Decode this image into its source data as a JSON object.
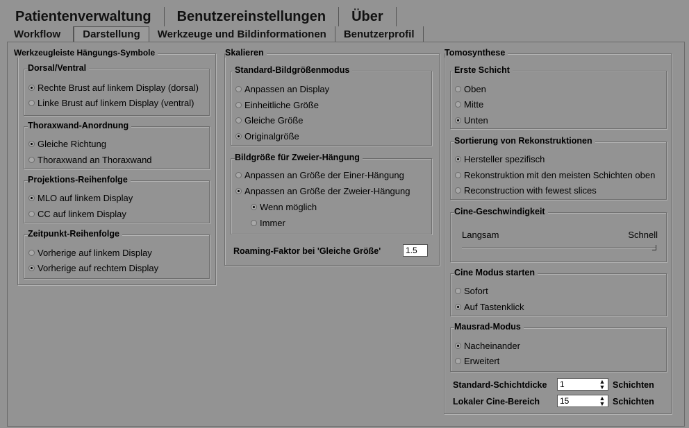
{
  "tabs_top": [
    "Patientenverwaltung",
    "Benutzereinstellungen",
    "Über"
  ],
  "tabs_sub": [
    "Workflow",
    "Darstellung",
    "Werkzeuge und Bildinformationen",
    "Benutzerprofil"
  ],
  "toolbar_group": {
    "title": "Werkzeugleiste Hängungs-Symbole",
    "dorsal": {
      "title": "Dorsal/Ventral",
      "options": [
        "Rechte Brust auf linkem Display (dorsal)",
        "Linke Brust auf linkem Display (ventral)"
      ],
      "selected": 0
    },
    "thorax": {
      "title": "Thoraxwand-Anordnung",
      "options": [
        "Gleiche Richtung",
        "Thoraxwand an Thoraxwand"
      ],
      "selected": 0
    },
    "projektion": {
      "title": "Projektions-Reihenfolge",
      "options": [
        "MLO auf linkem Display",
        "CC auf linkem Display"
      ],
      "selected": 0
    },
    "zeitpunkt": {
      "title": "Zeitpunkt-Reihenfolge",
      "options": [
        "Vorherige auf linkem Display",
        "Vorherige auf rechtem Display"
      ],
      "selected": 1
    }
  },
  "scale_group": {
    "title": "Skalieren",
    "standard": {
      "title": "Standard-Bildgrößenmodus",
      "options": [
        "Anpassen an Display",
        "Einheitliche Größe",
        "Gleiche Größe",
        "Originalgröße"
      ],
      "selected": 3
    },
    "zweier": {
      "title": "Bildgröße für Zweier-Hängung",
      "options": [
        "Anpassen an Größe der Einer-Hängung",
        "Anpassen an Größe der Zweier-Hängung"
      ],
      "selected": 1,
      "sub_options": [
        "Wenn möglich",
        "Immer"
      ],
      "sub_selected": 0
    },
    "roaming_label": "Roaming-Faktor bei 'Gleiche Größe'",
    "roaming_value": "1.5"
  },
  "tomo_group": {
    "title": "Tomosynthese",
    "erste": {
      "title": "Erste Schicht",
      "options": [
        "Oben",
        "Mitte",
        "Unten"
      ],
      "selected": 2
    },
    "sortierung": {
      "title": "Sortierung von Rekonstruktionen",
      "options": [
        "Hersteller spezifisch",
        "Rekonstruktion mit den meisten Schichten oben",
        "Reconstruction with fewest slices"
      ],
      "selected": 0
    },
    "cine_speed": {
      "title": "Cine-Geschwindigkeit",
      "slow": "Langsam",
      "fast": "Schnell",
      "level": 1.0
    },
    "cine_start": {
      "title": "Cine Modus starten",
      "options": [
        "Sofort",
        "Auf Tastenklick"
      ],
      "selected": 1
    },
    "mausrad": {
      "title": "Mausrad-Modus",
      "options": [
        "Nacheinander",
        "Erweitert"
      ],
      "selected": 0
    },
    "schichtdicke_label": "Standard-Schichtdicke",
    "schichtdicke_value": "1",
    "schichtdicke_unit": "Schichten",
    "cine_bereich_label": "Lokaler Cine-Bereich",
    "cine_bereich_value": "15",
    "cine_bereich_unit": "Schichten"
  }
}
